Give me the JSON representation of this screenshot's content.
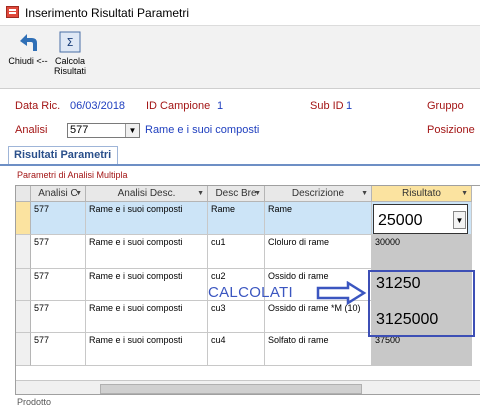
{
  "window": {
    "title": "Inserimento Risultati Parametri"
  },
  "toolbar": {
    "close_label": "Chiudi <--",
    "calc_label": "Calcola Risultati"
  },
  "header": {
    "data_ric_label": "Data Ric.",
    "data_ric_value": "06/03/2018",
    "id_campione_label": "ID Campione",
    "id_campione_value": "1",
    "sub_id_label": "Sub ID",
    "sub_id_value": "1",
    "gruppo_label": "Gruppo",
    "analisi_label": "Analisi",
    "analisi_value": "577",
    "analisi_desc": "Rame e i suoi composti",
    "posizione_label": "Posizione"
  },
  "tabs": {
    "active": "Risultati Parametri"
  },
  "grid": {
    "subtitle": "Parametri di Analisi Multipla",
    "columns": [
      "Analisi C",
      "Analisi Desc.",
      "Desc Bre",
      "Descrizione",
      "Risultato"
    ],
    "rows": [
      {
        "analisi": "577",
        "desc": "Rame e i suoi composti",
        "bre": "Rame",
        "descrizione": "Rame",
        "risultato": "25000"
      },
      {
        "analisi": "577",
        "desc": "Rame e i suoi composti",
        "bre": "cu1",
        "descrizione": "Cloluro di rame",
        "risultato": "30000"
      },
      {
        "analisi": "577",
        "desc": "Rame e i suoi composti",
        "bre": "cu2",
        "descrizione": "Ossido di rame",
        "risultato": "31250"
      },
      {
        "analisi": "577",
        "desc": "Rame e i suoi composti",
        "bre": "cu3",
        "descrizione": "Ossido di rame *M (10)",
        "risultato": "3125000"
      },
      {
        "analisi": "577",
        "desc": "Rame e i suoi composti",
        "bre": "cu4",
        "descrizione": "Solfato di rame",
        "risultato": "37500"
      }
    ]
  },
  "annotation": {
    "text": "CALCOLATI",
    "color": "#3b56c0"
  },
  "footer": {
    "partial_label": "Prodotto"
  }
}
